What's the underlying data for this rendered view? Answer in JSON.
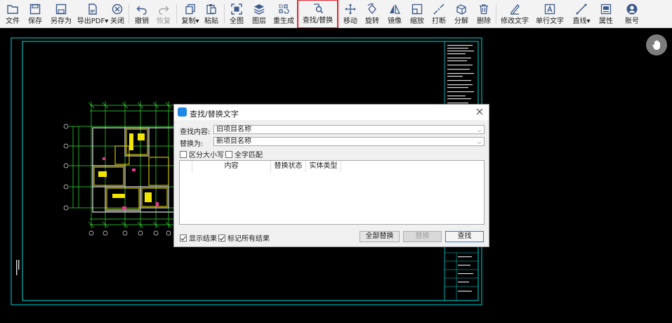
{
  "toolbar": {
    "buttons": [
      {
        "label": "文件",
        "icon": "open-folder-icon"
      },
      {
        "label": "保存",
        "icon": "save-icon"
      },
      {
        "label": "另存为",
        "icon": "save-as-icon"
      },
      {
        "label": "导出PDF",
        "icon": "export-pdf-icon"
      },
      {
        "label": "关闭",
        "icon": "close-circle-icon"
      },
      {
        "label": "撤销",
        "icon": "undo-icon"
      },
      {
        "label": "恢复",
        "icon": "redo-icon"
      },
      {
        "label": "复制",
        "icon": "copy-icon"
      },
      {
        "label": "粘贴",
        "icon": "paste-icon"
      },
      {
        "label": "全图",
        "icon": "fit-view-icon"
      },
      {
        "label": "图层",
        "icon": "layers-icon"
      },
      {
        "label": "重生成",
        "icon": "regenerate-icon"
      },
      {
        "label": "查找/替换",
        "icon": "find-replace-icon"
      },
      {
        "label": "移动",
        "icon": "move-icon"
      },
      {
        "label": "旋转",
        "icon": "rotate-icon"
      },
      {
        "label": "镜像",
        "icon": "mirror-icon"
      },
      {
        "label": "缩放",
        "icon": "scale-icon"
      },
      {
        "label": "打断",
        "icon": "break-icon"
      },
      {
        "label": "分解",
        "icon": "explode-icon"
      },
      {
        "label": "删除",
        "icon": "delete-icon"
      },
      {
        "label": "修改文字",
        "icon": "edit-text-icon"
      },
      {
        "label": "单行文字",
        "icon": "single-line-text-icon"
      },
      {
        "label": "直线",
        "icon": "line-icon"
      },
      {
        "label": "属性",
        "icon": "properties-icon"
      },
      {
        "label": "账号",
        "icon": "account-icon"
      }
    ]
  },
  "dialog": {
    "title": "查找/替换文字",
    "find_label": "查找内容:",
    "find_value": "旧项目名称",
    "replace_label": "替换为:",
    "replace_value": "新项目名称",
    "match_case": "区分大小写",
    "whole_word": "全字匹配",
    "columns": [
      "内容",
      "替换状态",
      "实体类型"
    ],
    "show_results": "显示结果",
    "mark_all": "标记所有结果",
    "replace_all": "全部替换",
    "replace": "替换",
    "find": "查找"
  },
  "colors": {
    "canvas_bg": "#000000",
    "frame_cyan": "#00d8d8",
    "highlight_red": "#e0242b",
    "drawing_yellow": "#f2e600",
    "drawing_green": "#32e632"
  }
}
